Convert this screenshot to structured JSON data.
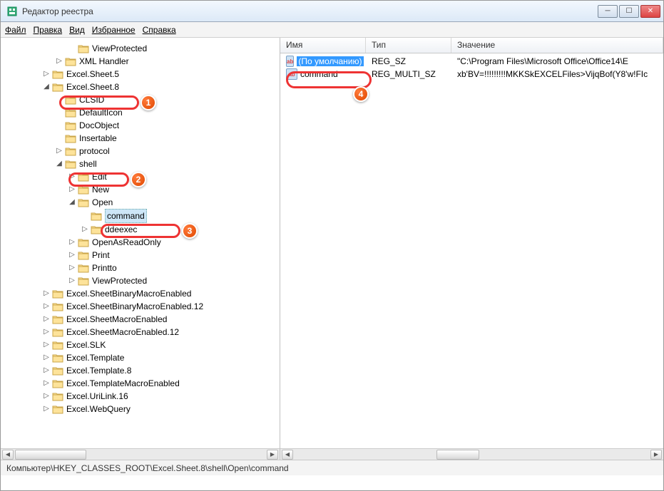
{
  "window": {
    "title": "Редактор реестра"
  },
  "menu": {
    "file": "Файл",
    "edit": "Правка",
    "view": "Вид",
    "favorites": "Избранное",
    "help": "Справка"
  },
  "tree": {
    "items": [
      {
        "indent": 5,
        "label": "ViewProtected",
        "toggle": ""
      },
      {
        "indent": 4,
        "label": "XML Handler",
        "toggle": "▷"
      },
      {
        "indent": 3,
        "label": "Excel.Sheet.5",
        "toggle": "▷"
      },
      {
        "indent": 3,
        "label": "Excel.Sheet.8",
        "toggle": "◢",
        "mark": 1
      },
      {
        "indent": 4,
        "label": "CLSID",
        "toggle": ""
      },
      {
        "indent": 4,
        "label": "DefaultIcon",
        "toggle": ""
      },
      {
        "indent": 4,
        "label": "DocObject",
        "toggle": ""
      },
      {
        "indent": 4,
        "label": "Insertable",
        "toggle": ""
      },
      {
        "indent": 4,
        "label": "protocol",
        "toggle": "▷"
      },
      {
        "indent": 4,
        "label": "shell",
        "toggle": "◢",
        "mark": 2
      },
      {
        "indent": 5,
        "label": "Edit",
        "toggle": "▷"
      },
      {
        "indent": 5,
        "label": "New",
        "toggle": "▷"
      },
      {
        "indent": 5,
        "label": "Open",
        "toggle": "◢"
      },
      {
        "indent": 6,
        "label": "command",
        "toggle": "",
        "selected": true,
        "mark": 3
      },
      {
        "indent": 6,
        "label": "ddeexec",
        "toggle": "▷"
      },
      {
        "indent": 5,
        "label": "OpenAsReadOnly",
        "toggle": "▷"
      },
      {
        "indent": 5,
        "label": "Print",
        "toggle": "▷"
      },
      {
        "indent": 5,
        "label": "Printto",
        "toggle": "▷"
      },
      {
        "indent": 5,
        "label": "ViewProtected",
        "toggle": "▷"
      },
      {
        "indent": 3,
        "label": "Excel.SheetBinaryMacroEnabled",
        "toggle": "▷"
      },
      {
        "indent": 3,
        "label": "Excel.SheetBinaryMacroEnabled.12",
        "toggle": "▷"
      },
      {
        "indent": 3,
        "label": "Excel.SheetMacroEnabled",
        "toggle": "▷"
      },
      {
        "indent": 3,
        "label": "Excel.SheetMacroEnabled.12",
        "toggle": "▷"
      },
      {
        "indent": 3,
        "label": "Excel.SLK",
        "toggle": "▷"
      },
      {
        "indent": 3,
        "label": "Excel.Template",
        "toggle": "▷"
      },
      {
        "indent": 3,
        "label": "Excel.Template.8",
        "toggle": "▷"
      },
      {
        "indent": 3,
        "label": "Excel.TemplateMacroEnabled",
        "toggle": "▷"
      },
      {
        "indent": 3,
        "label": "Excel.UriLink.16",
        "toggle": "▷"
      },
      {
        "indent": 3,
        "label": "Excel.WebQuery",
        "toggle": "▷"
      }
    ]
  },
  "columns": {
    "name": "Имя",
    "type": "Тип",
    "value": "Значение"
  },
  "rows": [
    {
      "name": "(По умолчанию)",
      "type": "REG_SZ",
      "value": "\"C:\\Program Files\\Microsoft Office\\Office14\\E",
      "selected": true,
      "mark": 4
    },
    {
      "name": "command",
      "type": "REG_MULTI_SZ",
      "value": "xb'BV=!!!!!!!!!MKKSkEXCELFiles>VijqBof(Y8'w!FIc"
    }
  ],
  "status": {
    "path": "Компьютер\\HKEY_CLASSES_ROOT\\Excel.Sheet.8\\shell\\Open\\command"
  },
  "callouts": {
    "1": "1",
    "2": "2",
    "3": "3",
    "4": "4"
  }
}
